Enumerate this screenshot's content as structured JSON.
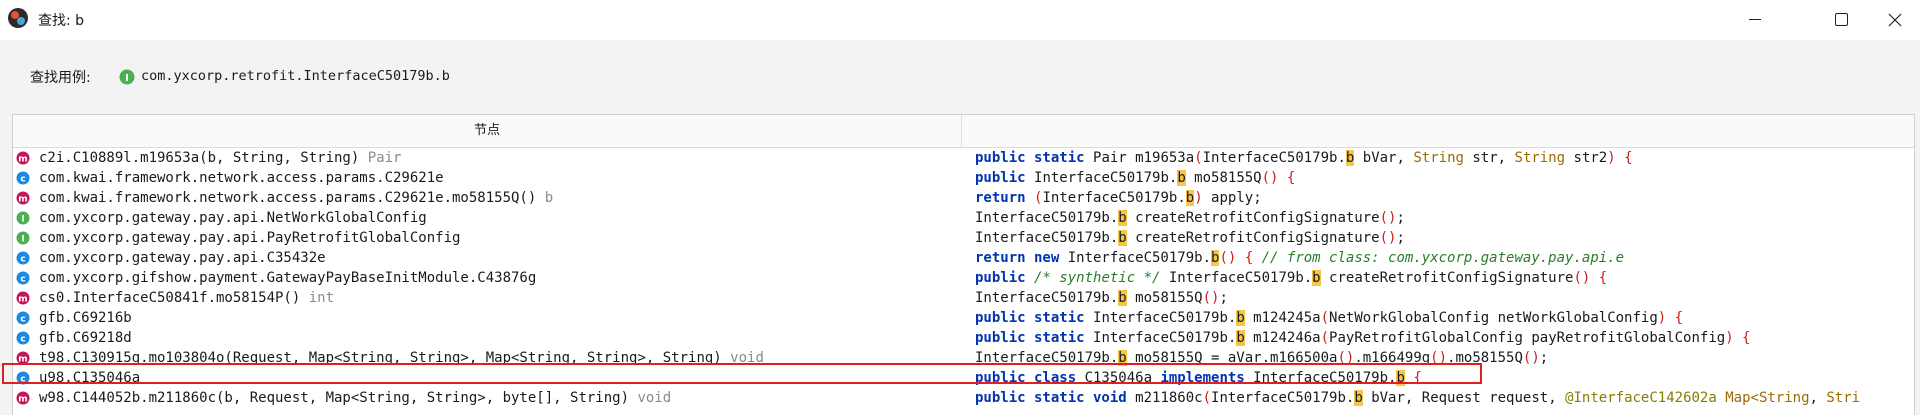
{
  "window": {
    "title": "查找: b",
    "icons": {
      "app": "jadx-app-icon",
      "minimize": "minimize-icon",
      "maximize": "maximize-icon",
      "close": "close-icon"
    }
  },
  "usage": {
    "label": "查找用例:",
    "icon": "interface-icon",
    "value": "com.yxcorp.retrofit.InterfaceC50179b.b"
  },
  "table": {
    "column_node": "节点",
    "rows": [
      {
        "icon": "m",
        "icon_color": "#c2185b",
        "node": "c2i.C10889l.m19653a(b, String, String)",
        "suffix": " Pair",
        "code": [
          {
            "t": "public static ",
            "c": "kw"
          },
          {
            "t": "Pair m19653a"
          },
          {
            "t": "(",
            "c": "pu"
          },
          {
            "t": "InterfaceC50179b."
          },
          {
            "t": "b",
            "c": "hl"
          },
          {
            "t": " bVar, "
          },
          {
            "t": "String",
            "c": "ty"
          },
          {
            "t": " str, "
          },
          {
            "t": "String",
            "c": "ty"
          },
          {
            "t": " str2"
          },
          {
            "t": ") {",
            "c": "pu"
          }
        ]
      },
      {
        "icon": "c",
        "icon_color": "#1e88e5",
        "node": "com.kwai.framework.network.access.params.C29621e",
        "suffix": "",
        "code": [
          {
            "t": "public ",
            "c": "kw"
          },
          {
            "t": "InterfaceC50179b."
          },
          {
            "t": "b",
            "c": "hl"
          },
          {
            "t": " mo58155Q"
          },
          {
            "t": "() {",
            "c": "pu"
          }
        ]
      },
      {
        "icon": "m",
        "icon_color": "#c2185b",
        "node": "com.kwai.framework.network.access.params.C29621e.mo58155Q()",
        "suffix": " b",
        "code": [
          {
            "t": "return ",
            "c": "kw"
          },
          {
            "t": "(",
            "c": "pu"
          },
          {
            "t": "InterfaceC50179b."
          },
          {
            "t": "b",
            "c": "hl"
          },
          {
            "t": ")",
            "c": "pu"
          },
          {
            "t": " apply;"
          }
        ]
      },
      {
        "icon": "I",
        "icon_color": "#4caf50",
        "node": "com.yxcorp.gateway.pay.api.NetWorkGlobalConfig",
        "suffix": "",
        "code": [
          {
            "t": "InterfaceC50179b."
          },
          {
            "t": "b",
            "c": "hl"
          },
          {
            "t": " createRetrofitConfigSignature"
          },
          {
            "t": "()",
            "c": "pu"
          },
          {
            "t": ";"
          }
        ]
      },
      {
        "icon": "I",
        "icon_color": "#4caf50",
        "node": "com.yxcorp.gateway.pay.api.PayRetrofitGlobalConfig",
        "suffix": "",
        "code": [
          {
            "t": "InterfaceC50179b."
          },
          {
            "t": "b",
            "c": "hl"
          },
          {
            "t": " createRetrofitConfigSignature"
          },
          {
            "t": "()",
            "c": "pu"
          },
          {
            "t": ";"
          }
        ]
      },
      {
        "icon": "c",
        "icon_color": "#1e88e5",
        "node": "com.yxcorp.gateway.pay.api.C35432e",
        "suffix": "",
        "code": [
          {
            "t": "return new ",
            "c": "kw"
          },
          {
            "t": "InterfaceC50179b."
          },
          {
            "t": "b",
            "c": "hl"
          },
          {
            "t": "() {",
            "c": "pu"
          },
          {
            "t": " // from class: com.yxcorp.gateway.pay.api.e",
            "c": "cm"
          }
        ]
      },
      {
        "icon": "c",
        "icon_color": "#1e88e5",
        "node": "com.yxcorp.gifshow.payment.GatewayPayBaseInitModule.C43876g",
        "suffix": "",
        "code": [
          {
            "t": "public ",
            "c": "kw"
          },
          {
            "t": "/* synthetic */",
            "c": "cm"
          },
          {
            "t": " InterfaceC50179b."
          },
          {
            "t": "b",
            "c": "hl"
          },
          {
            "t": " createRetrofitConfigSignature"
          },
          {
            "t": "() {",
            "c": "pu"
          }
        ]
      },
      {
        "icon": "m",
        "icon_color": "#c2185b",
        "node": "cs0.InterfaceC50841f.mo58154P()",
        "suffix": " int",
        "code": [
          {
            "t": "InterfaceC50179b."
          },
          {
            "t": "b",
            "c": "hl"
          },
          {
            "t": " mo58155Q"
          },
          {
            "t": "()",
            "c": "pu"
          },
          {
            "t": ";"
          }
        ]
      },
      {
        "icon": "c",
        "icon_color": "#1e88e5",
        "node": "gfb.C69216b",
        "suffix": "",
        "code": [
          {
            "t": "public static ",
            "c": "kw"
          },
          {
            "t": "InterfaceC50179b."
          },
          {
            "t": "b",
            "c": "hl"
          },
          {
            "t": " m124245a"
          },
          {
            "t": "(",
            "c": "pu"
          },
          {
            "t": "NetWorkGlobalConfig netWorkGlobalConfig"
          },
          {
            "t": ") {",
            "c": "pu"
          }
        ]
      },
      {
        "icon": "c",
        "icon_color": "#1e88e5",
        "node": "gfb.C69218d",
        "suffix": "",
        "code": [
          {
            "t": "public static ",
            "c": "kw"
          },
          {
            "t": "InterfaceC50179b."
          },
          {
            "t": "b",
            "c": "hl"
          },
          {
            "t": " m124246a"
          },
          {
            "t": "(",
            "c": "pu"
          },
          {
            "t": "PayRetrofitGlobalConfig payRetrofitGlobalConfig"
          },
          {
            "t": ") {",
            "c": "pu"
          }
        ]
      },
      {
        "icon": "m",
        "icon_color": "#c2185b",
        "node": "t98.C130915g.mo103804o(Request, Map<String, String>, Map<String, String>, String)",
        "suffix": " void",
        "code": [
          {
            "t": "InterfaceC50179b."
          },
          {
            "t": "b",
            "c": "hl"
          },
          {
            "t": " mo58155Q = aVar.m166500a"
          },
          {
            "t": "()",
            "c": "pu"
          },
          {
            "t": ".m166499g"
          },
          {
            "t": "()",
            "c": "pu"
          },
          {
            "t": ".mo58155Q"
          },
          {
            "t": "()",
            "c": "pu"
          },
          {
            "t": ";"
          }
        ]
      },
      {
        "icon": "c",
        "icon_color": "#1e88e5",
        "node": "u98.C135046a",
        "suffix": "",
        "code": [
          {
            "t": "public class ",
            "c": "kw"
          },
          {
            "t": "C135046a "
          },
          {
            "t": "implements ",
            "c": "kw"
          },
          {
            "t": "InterfaceC50179b."
          },
          {
            "t": "b",
            "c": "hl"
          },
          {
            "t": " {",
            "c": "pu"
          }
        ]
      },
      {
        "icon": "m",
        "icon_color": "#c2185b",
        "node": "w98.C144052b.m211860c(b, Request, Map<String, String>, byte[], String)",
        "suffix": " void",
        "code": [
          {
            "t": "public static void ",
            "c": "kw"
          },
          {
            "t": "m211860c"
          },
          {
            "t": "(",
            "c": "pu"
          },
          {
            "t": "InterfaceC50179b."
          },
          {
            "t": "b",
            "c": "hl"
          },
          {
            "t": " bVar, Request request, "
          },
          {
            "t": "@InterfaceC142602a ",
            "c": "an"
          },
          {
            "t": "Map<",
            "c": "ty"
          },
          {
            "t": "String",
            "c": "ty"
          },
          {
            "t": ", "
          },
          {
            "t": "Stri",
            "c": "ty"
          }
        ]
      }
    ],
    "selected_index": 11
  }
}
